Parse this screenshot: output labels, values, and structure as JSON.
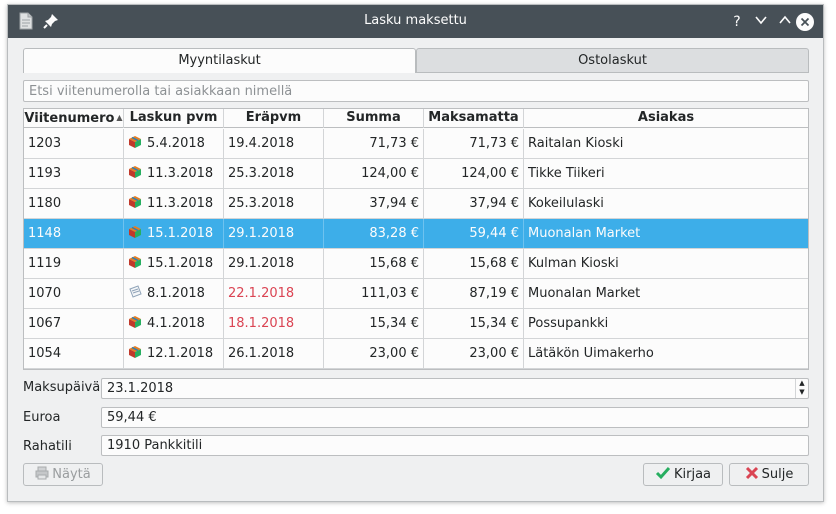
{
  "window": {
    "title": "Lasku maksettu"
  },
  "titlebar": {
    "help": "?",
    "minimize": "⌵",
    "maximize": "^",
    "close": "✕"
  },
  "tabs": [
    {
      "label": "Myyntilaskut"
    },
    {
      "label": "Ostolaskut"
    }
  ],
  "search": {
    "placeholder": "Etsi viitenumerolla tai asiakkaan nimellä",
    "value": ""
  },
  "table": {
    "columns": [
      "Viitenumero",
      "Laskun pvm",
      "Eräpvm",
      "Summa",
      "Maksamatta",
      "Asiakas"
    ],
    "rows": [
      {
        "ref": "1203",
        "icon": "box-icon",
        "date": "5.4.2018",
        "due": "19.4.2018",
        "due_overdue": false,
        "sum": "71,73 €",
        "unpaid": "71,73 €",
        "customer": "Raitalan Kioski"
      },
      {
        "ref": "1193",
        "icon": "box-icon",
        "date": "11.3.2018",
        "due": "25.3.2018",
        "due_overdue": false,
        "sum": "124,00 €",
        "unpaid": "124,00 €",
        "customer": "Tikke Tiikeri"
      },
      {
        "ref": "1180",
        "icon": "box-icon",
        "date": "11.3.2018",
        "due": "25.3.2018",
        "due_overdue": false,
        "sum": "37,94 €",
        "unpaid": "37,94 €",
        "customer": "Kokeilulaski"
      },
      {
        "ref": "1148",
        "icon": "box-icon",
        "date": "15.1.2018",
        "due": "29.1.2018",
        "due_overdue": false,
        "sum": "83,28 €",
        "unpaid": "59,44 €",
        "customer": "Muonalan Market",
        "selected": true
      },
      {
        "ref": "1119",
        "icon": "box-icon",
        "date": "15.1.2018",
        "due": "29.1.2018",
        "due_overdue": false,
        "sum": "15,68 €",
        "unpaid": "15,68 €",
        "customer": "Kulman Kioski"
      },
      {
        "ref": "1070",
        "icon": "paper-icon",
        "date": "8.1.2018",
        "due": "22.1.2018",
        "due_overdue": true,
        "sum": "111,03 €",
        "unpaid": "87,19 €",
        "customer": "Muonalan Market"
      },
      {
        "ref": "1067",
        "icon": "box-icon",
        "date": "4.1.2018",
        "due": "18.1.2018",
        "due_overdue": true,
        "sum": "15,34 €",
        "unpaid": "15,34 €",
        "customer": "Possupankki"
      },
      {
        "ref": "1054",
        "icon": "box-icon",
        "date": "12.1.2018",
        "due": "26.1.2018",
        "due_overdue": false,
        "sum": "23,00 €",
        "unpaid": "23,00 €",
        "customer": "Lätäkön Uimakerho"
      }
    ]
  },
  "form": {
    "payment_date_label": "Maksupäivä",
    "payment_date_value": "23.1.2018",
    "euro_label": "Euroa",
    "euro_value": "59,44 €",
    "account_label": "Rahatili",
    "account_value": "1910 Pankkitili"
  },
  "buttons": {
    "show": "Näytä",
    "book": "Kirjaa",
    "close": "Sulje"
  },
  "colors": {
    "selection": "#3daee9",
    "overdue": "#da4453",
    "titlebar": "#475057"
  }
}
